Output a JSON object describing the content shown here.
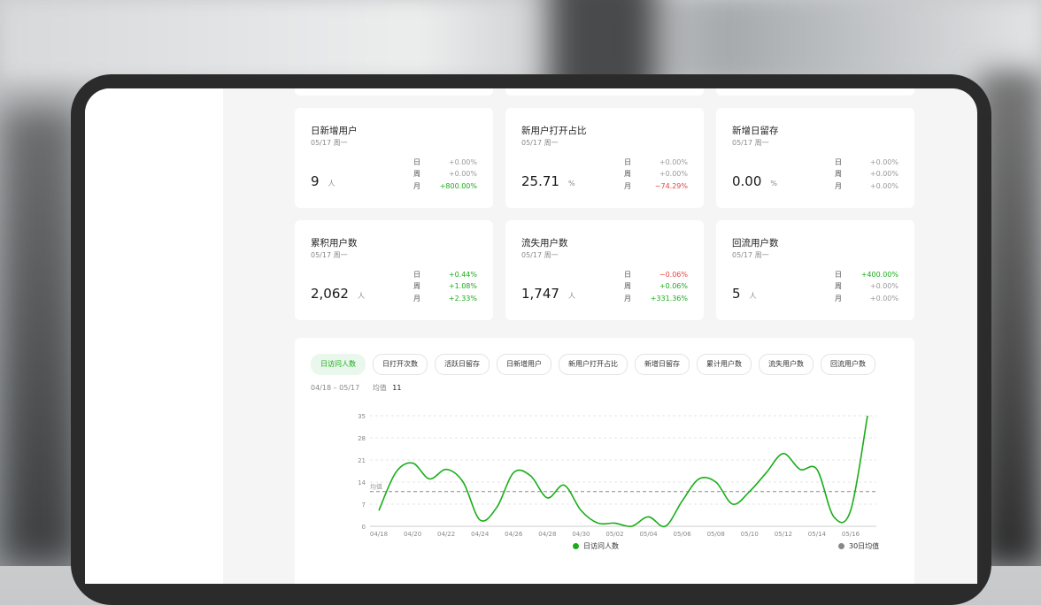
{
  "metrics": [
    {
      "title": "日新增用户",
      "date": "05/17 周一",
      "value": "9",
      "unit": "人",
      "cmp": [
        {
          "label": "日",
          "value": "+0.00%",
          "trend": "neutral"
        },
        {
          "label": "周",
          "value": "+0.00%",
          "trend": "neutral"
        },
        {
          "label": "月",
          "value": "+800.00%",
          "trend": "up"
        }
      ]
    },
    {
      "title": "新用户打开占比",
      "date": "05/17 周一",
      "value": "25.71",
      "unit": "%",
      "cmp": [
        {
          "label": "日",
          "value": "+0.00%",
          "trend": "neutral"
        },
        {
          "label": "周",
          "value": "+0.00%",
          "trend": "neutral"
        },
        {
          "label": "月",
          "value": "−74.29%",
          "trend": "down"
        }
      ]
    },
    {
      "title": "新增日留存",
      "date": "05/17 周一",
      "value": "0.00",
      "unit": "%",
      "cmp": [
        {
          "label": "日",
          "value": "+0.00%",
          "trend": "neutral"
        },
        {
          "label": "周",
          "value": "+0.00%",
          "trend": "neutral"
        },
        {
          "label": "月",
          "value": "+0.00%",
          "trend": "neutral"
        }
      ]
    },
    {
      "title": "累积用户数",
      "date": "05/17 周一",
      "value": "2,062",
      "unit": "人",
      "cmp": [
        {
          "label": "日",
          "value": "+0.44%",
          "trend": "up"
        },
        {
          "label": "周",
          "value": "+1.08%",
          "trend": "up"
        },
        {
          "label": "月",
          "value": "+2.33%",
          "trend": "up"
        }
      ]
    },
    {
      "title": "流失用户数",
      "date": "05/17 周一",
      "value": "1,747",
      "unit": "人",
      "cmp": [
        {
          "label": "日",
          "value": "−0.06%",
          "trend": "down"
        },
        {
          "label": "周",
          "value": "+0.06%",
          "trend": "up"
        },
        {
          "label": "月",
          "value": "+331.36%",
          "trend": "up"
        }
      ]
    },
    {
      "title": "回流用户数",
      "date": "05/17 周一",
      "value": "5",
      "unit": "人",
      "cmp": [
        {
          "label": "日",
          "value": "+400.00%",
          "trend": "up"
        },
        {
          "label": "周",
          "value": "+0.00%",
          "trend": "neutral"
        },
        {
          "label": "月",
          "value": "+0.00%",
          "trend": "neutral"
        }
      ]
    }
  ],
  "chart_tabs": [
    "日访问人数",
    "日打开次数",
    "活跃日留存",
    "日新增用户",
    "新用户打开占比",
    "新增日留存",
    "累计用户数",
    "流失用户数",
    "回流用户数"
  ],
  "active_tab": 0,
  "range": {
    "text": "04/18 – 05/17",
    "avg_label": "均值",
    "avg_value": "11"
  },
  "colors": {
    "accent": "#1aad19",
    "negative": "#e64340",
    "avg_line": "#888888"
  },
  "chart_data": {
    "type": "line",
    "yticks": [
      0,
      7,
      14,
      21,
      28,
      35
    ],
    "ylim": [
      0,
      35
    ],
    "x_tick_labels": [
      "04/18",
      "04/20",
      "04/22",
      "04/24",
      "04/26",
      "04/28",
      "04/30",
      "05/02",
      "05/04",
      "05/06",
      "05/08",
      "05/10",
      "05/12",
      "05/14",
      "05/16"
    ],
    "x": [
      "04/18",
      "04/19",
      "04/20",
      "04/21",
      "04/22",
      "04/23",
      "04/24",
      "04/25",
      "04/26",
      "04/27",
      "04/28",
      "04/29",
      "04/30",
      "05/01",
      "05/02",
      "05/03",
      "05/04",
      "05/05",
      "05/06",
      "05/07",
      "05/08",
      "05/09",
      "05/10",
      "05/11",
      "05/12",
      "05/13",
      "05/14",
      "05/15",
      "05/16",
      "05/17"
    ],
    "series": [
      {
        "name": "日访问人数",
        "values": [
          5,
          17,
          20,
          15,
          18,
          14,
          2,
          6,
          17,
          16,
          9,
          13,
          5,
          1,
          1,
          0,
          3,
          0,
          8,
          15,
          14,
          7,
          11,
          17,
          23,
          18,
          18,
          3,
          5,
          35
        ]
      }
    ],
    "average": {
      "label": "均值",
      "value": 11
    },
    "legend": [
      "日访问人数",
      "30日均值"
    ]
  }
}
